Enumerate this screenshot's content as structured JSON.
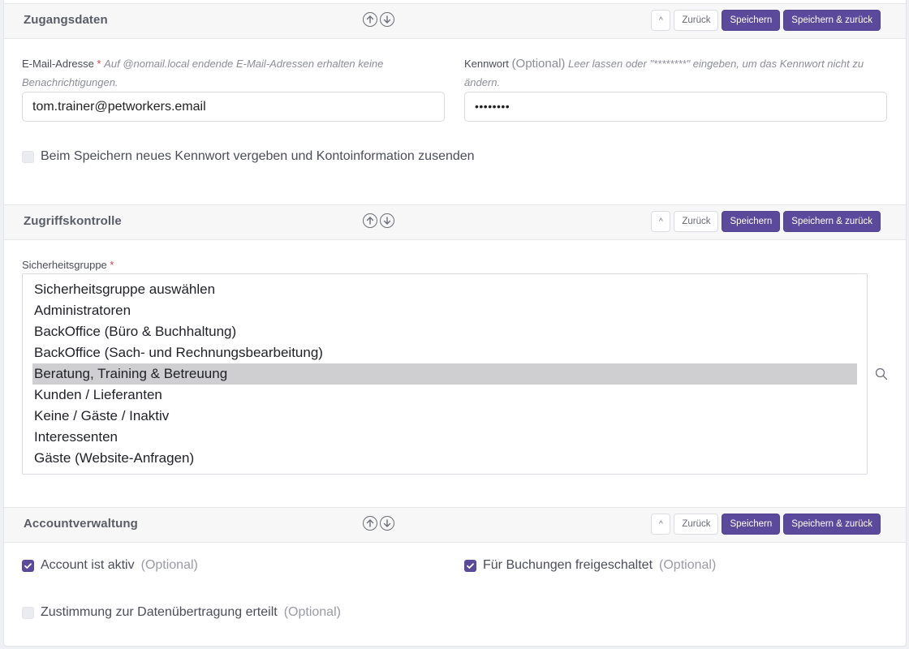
{
  "buttons": {
    "collapse": "^",
    "back": "Zurück",
    "save": "Speichern",
    "save_back": "Speichern & zurück"
  },
  "icons": {
    "move_up": "arrow-up-circle-icon",
    "move_down": "arrow-down-circle-icon",
    "check": "check-icon",
    "search": "search-icon"
  },
  "colors": {
    "primary": "#5b4a9c",
    "required": "#d33f49",
    "selected_option_bg": "#cfcfd1"
  },
  "access_data": {
    "title": "Zugangsdaten",
    "email": {
      "label": "E-Mail-Adresse",
      "required_mark": "*",
      "help": "Auf @nomail.local endende E-Mail-Adressen erhalten keine Benachrichtigungen.",
      "value": "tom.trainer@petworkers.email"
    },
    "password": {
      "label": "Kennwort",
      "optional": "(Optional)",
      "help": "Leer lassen oder \"********\" eingeben, um das Kennwort nicht zu ändern.",
      "value": "••••••••"
    },
    "send_checkbox": {
      "label": "Beim Speichern neues Kennwort vergeben und Kontoinformation zusenden",
      "checked": false
    }
  },
  "access_control": {
    "title": "Zugriffskontrolle",
    "group_label": "Sicherheitsgruppe",
    "required_mark": "*",
    "options": [
      "Sicherheitsgruppe auswählen",
      "Administratoren",
      "BackOffice (Büro & Buchhaltung)",
      "BackOffice (Sach- und Rechnungsbearbeitung)",
      "Beratung, Training & Betreuung",
      "Kunden / Lieferanten",
      "Keine / Gäste / Inaktiv",
      "Interessenten",
      "Gäste (Website-Anfragen)"
    ],
    "selected": "Beratung, Training & Betreuung"
  },
  "account": {
    "title": "Accountverwaltung",
    "active": {
      "label": "Account ist aktiv",
      "optional": "(Optional)",
      "checked": true
    },
    "booking": {
      "label": "Für Buchungen freigeschaltet",
      "optional": "(Optional)",
      "checked": true
    },
    "consent": {
      "label": "Zustimmung zur Datenübertragung erteilt",
      "optional": "(Optional)",
      "checked": false
    }
  }
}
